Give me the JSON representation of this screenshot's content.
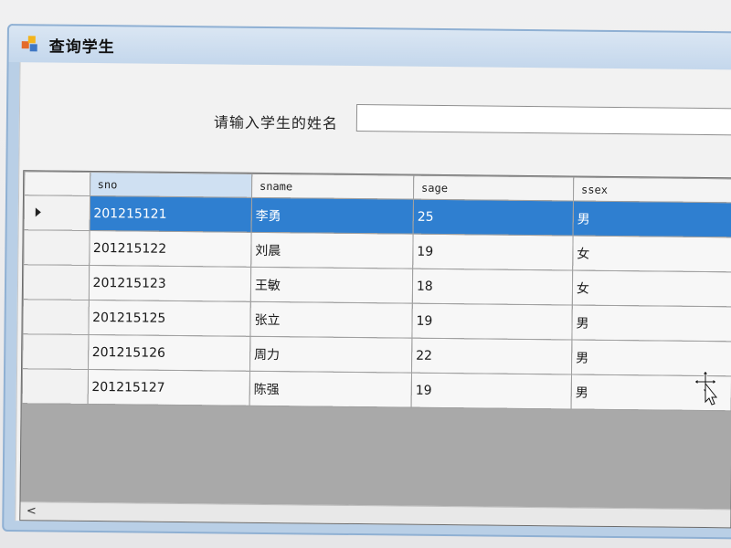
{
  "window": {
    "title": "查询学生",
    "icon": "app-icon"
  },
  "search": {
    "label": "请输入学生的姓名",
    "value": "",
    "placeholder": ""
  },
  "table": {
    "columns": [
      "sno",
      "sname",
      "sage",
      "ssex"
    ],
    "selected_row": 0,
    "rows": [
      [
        "201215121",
        "李勇",
        "25",
        "男"
      ],
      [
        "201215122",
        "刘晨",
        "19",
        "女"
      ],
      [
        "201215123",
        "王敏",
        "18",
        "女"
      ],
      [
        "201215125",
        "张立",
        "19",
        "男"
      ],
      [
        "201215126",
        "周力",
        "22",
        "男"
      ],
      [
        "201215127",
        "陈强",
        "19",
        "男"
      ]
    ]
  },
  "scrollbar": {
    "left_arrow": "<"
  },
  "colors": {
    "selection": "#2f7fd0",
    "titlebar": "#c4d7ec"
  }
}
